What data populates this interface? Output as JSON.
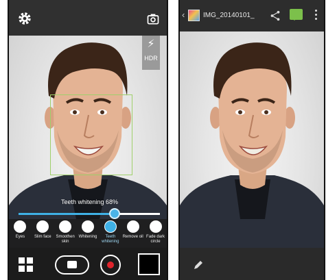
{
  "left_screen": {
    "side_controls": {
      "hdr_label": "HDR"
    },
    "slider": {
      "label": "Teeth whitening 68%",
      "value_fraction": 0.68
    },
    "tools": [
      {
        "label": "Eyes",
        "icon": "eye-icon"
      },
      {
        "label": "Slim face",
        "icon": "slim-face-icon"
      },
      {
        "label": "Smoothen skin",
        "icon": "smoothen-skin-icon"
      },
      {
        "label": "Whitening",
        "icon": "whitening-icon"
      },
      {
        "label": "Teeth whitening",
        "icon": "teeth-icon",
        "active": true
      },
      {
        "label": "Remove oil",
        "icon": "drop-icon"
      },
      {
        "label": "Fade dark circle",
        "icon": "dark-circle-icon"
      }
    ]
  },
  "right_screen": {
    "title": "IMG_20140101_",
    "icons": [
      "share-icon",
      "message-icon",
      "overflow-menu-icon",
      "pencil-icon"
    ]
  },
  "colors": {
    "accent": "#3fb1e6",
    "face_box": "#9fd06a",
    "record": "#e0242c",
    "message": "#7cc04b"
  }
}
